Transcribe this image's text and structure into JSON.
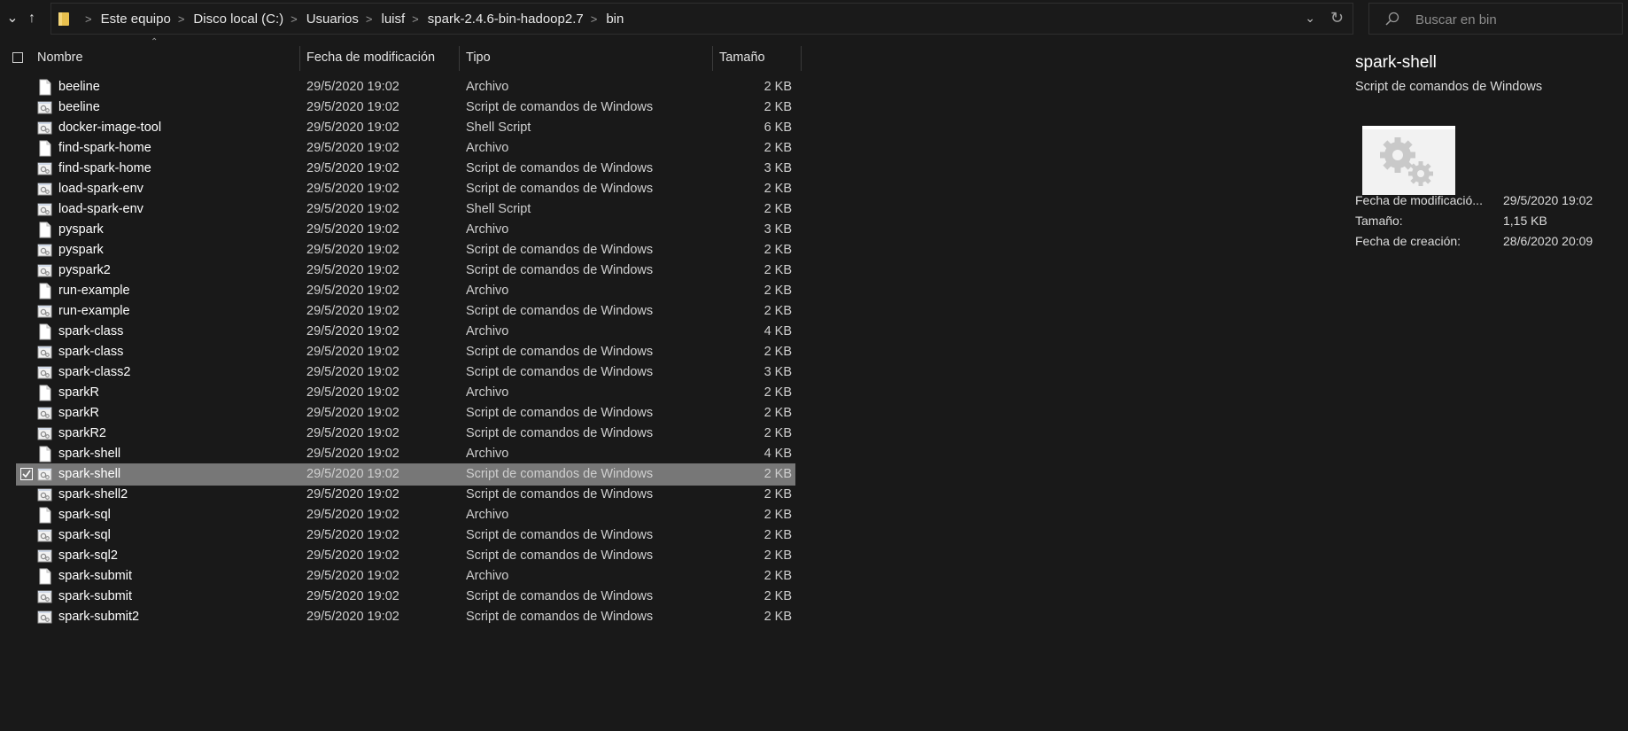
{
  "address_bar": {
    "breadcrumbs": [
      "Este equipo",
      "Disco local (C:)",
      "Usuarios",
      "luisf",
      "spark-2.4.6-bin-hadoop2.7",
      "bin"
    ],
    "search_placeholder": "Buscar en bin"
  },
  "columns": {
    "name": "Nombre",
    "date": "Fecha de modificación",
    "type": "Tipo",
    "size": "Tamaño"
  },
  "files": [
    {
      "name": "beeline",
      "date": "29/5/2020 19:02",
      "type": "Archivo",
      "size": "2 KB",
      "icon": "blank-file-icon"
    },
    {
      "name": "beeline",
      "date": "29/5/2020 19:02",
      "type": "Script de comandos de Windows",
      "size": "2 KB",
      "icon": "script-file-icon"
    },
    {
      "name": "docker-image-tool",
      "date": "29/5/2020 19:02",
      "type": "Shell Script",
      "size": "6 KB",
      "icon": "script-file-icon"
    },
    {
      "name": "find-spark-home",
      "date": "29/5/2020 19:02",
      "type": "Archivo",
      "size": "2 KB",
      "icon": "blank-file-icon"
    },
    {
      "name": "find-spark-home",
      "date": "29/5/2020 19:02",
      "type": "Script de comandos de Windows",
      "size": "3 KB",
      "icon": "script-file-icon"
    },
    {
      "name": "load-spark-env",
      "date": "29/5/2020 19:02",
      "type": "Script de comandos de Windows",
      "size": "2 KB",
      "icon": "script-file-icon"
    },
    {
      "name": "load-spark-env",
      "date": "29/5/2020 19:02",
      "type": "Shell Script",
      "size": "2 KB",
      "icon": "script-file-icon"
    },
    {
      "name": "pyspark",
      "date": "29/5/2020 19:02",
      "type": "Archivo",
      "size": "3 KB",
      "icon": "blank-file-icon"
    },
    {
      "name": "pyspark",
      "date": "29/5/2020 19:02",
      "type": "Script de comandos de Windows",
      "size": "2 KB",
      "icon": "script-file-icon"
    },
    {
      "name": "pyspark2",
      "date": "29/5/2020 19:02",
      "type": "Script de comandos de Windows",
      "size": "2 KB",
      "icon": "script-file-icon"
    },
    {
      "name": "run-example",
      "date": "29/5/2020 19:02",
      "type": "Archivo",
      "size": "2 KB",
      "icon": "blank-file-icon"
    },
    {
      "name": "run-example",
      "date": "29/5/2020 19:02",
      "type": "Script de comandos de Windows",
      "size": "2 KB",
      "icon": "script-file-icon"
    },
    {
      "name": "spark-class",
      "date": "29/5/2020 19:02",
      "type": "Archivo",
      "size": "4 KB",
      "icon": "blank-file-icon"
    },
    {
      "name": "spark-class",
      "date": "29/5/2020 19:02",
      "type": "Script de comandos de Windows",
      "size": "2 KB",
      "icon": "script-file-icon"
    },
    {
      "name": "spark-class2",
      "date": "29/5/2020 19:02",
      "type": "Script de comandos de Windows",
      "size": "3 KB",
      "icon": "script-file-icon"
    },
    {
      "name": "sparkR",
      "date": "29/5/2020 19:02",
      "type": "Archivo",
      "size": "2 KB",
      "icon": "blank-file-icon"
    },
    {
      "name": "sparkR",
      "date": "29/5/2020 19:02",
      "type": "Script de comandos de Windows",
      "size": "2 KB",
      "icon": "script-file-icon"
    },
    {
      "name": "sparkR2",
      "date": "29/5/2020 19:02",
      "type": "Script de comandos de Windows",
      "size": "2 KB",
      "icon": "script-file-icon"
    },
    {
      "name": "spark-shell",
      "date": "29/5/2020 19:02",
      "type": "Archivo",
      "size": "4 KB",
      "icon": "blank-file-icon"
    },
    {
      "name": "spark-shell",
      "date": "29/5/2020 19:02",
      "type": "Script de comandos de Windows",
      "size": "2 KB",
      "icon": "script-file-icon",
      "selected": true
    },
    {
      "name": "spark-shell2",
      "date": "29/5/2020 19:02",
      "type": "Script de comandos de Windows",
      "size": "2 KB",
      "icon": "script-file-icon"
    },
    {
      "name": "spark-sql",
      "date": "29/5/2020 19:02",
      "type": "Archivo",
      "size": "2 KB",
      "icon": "blank-file-icon"
    },
    {
      "name": "spark-sql",
      "date": "29/5/2020 19:02",
      "type": "Script de comandos de Windows",
      "size": "2 KB",
      "icon": "script-file-icon"
    },
    {
      "name": "spark-sql2",
      "date": "29/5/2020 19:02",
      "type": "Script de comandos de Windows",
      "size": "2 KB",
      "icon": "script-file-icon"
    },
    {
      "name": "spark-submit",
      "date": "29/5/2020 19:02",
      "type": "Archivo",
      "size": "2 KB",
      "icon": "blank-file-icon"
    },
    {
      "name": "spark-submit",
      "date": "29/5/2020 19:02",
      "type": "Script de comandos de Windows",
      "size": "2 KB",
      "icon": "script-file-icon"
    },
    {
      "name": "spark-submit2",
      "date": "29/5/2020 19:02",
      "type": "Script de comandos de Windows",
      "size": "2 KB",
      "icon": "script-file-icon"
    }
  ],
  "details": {
    "title": "spark-shell",
    "subtitle": "Script de comandos de Windows",
    "thumbnail_icon": "gears-icon",
    "properties": [
      {
        "label": "Fecha de modificació...",
        "value": "29/5/2020 19:02"
      },
      {
        "label": "Tamaño:",
        "value": "1,15 KB"
      },
      {
        "label": "Fecha de creación:",
        "value": "28/6/2020 20:09"
      }
    ]
  },
  "colors": {
    "background": "#191919",
    "selected_row": "#777777",
    "text_primary": "#ffffff",
    "text_secondary": "#cfcfcf",
    "folder_yellow": "#e8c04e"
  }
}
